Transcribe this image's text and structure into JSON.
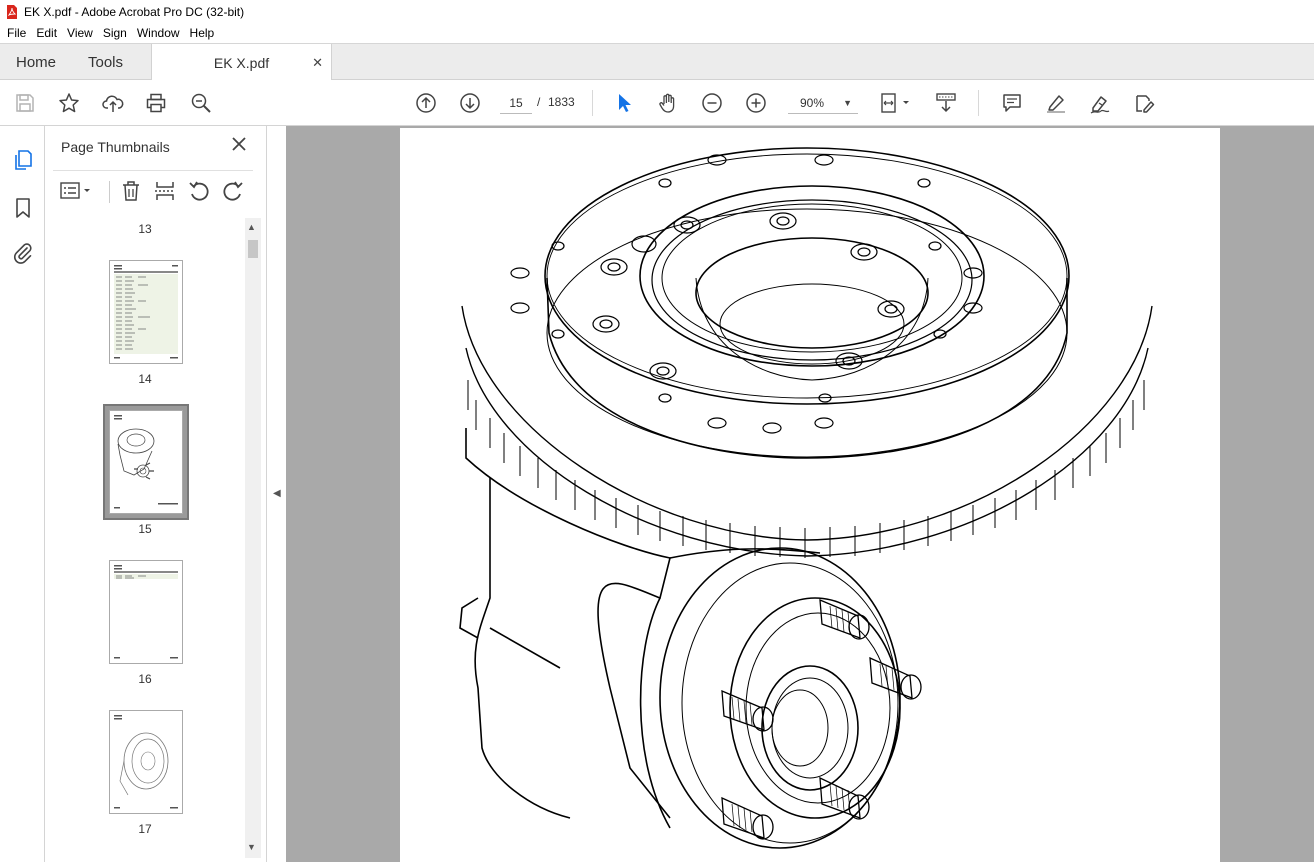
{
  "window": {
    "title": "EK X.pdf - Adobe Acrobat Pro DC (32-bit)"
  },
  "menu": {
    "items": [
      "File",
      "Edit",
      "View",
      "Sign",
      "Window",
      "Help"
    ]
  },
  "tabs": {
    "home": "Home",
    "tools": "Tools",
    "document": "EK X.pdf"
  },
  "toolbar": {
    "current_page": "15",
    "page_separator": "/",
    "total_pages": "1833",
    "zoom": "90%"
  },
  "thumbnails_panel": {
    "title": "Page Thumbnails",
    "pages": [
      {
        "number": "13"
      },
      {
        "number": "14"
      },
      {
        "number": "15",
        "selected": true
      },
      {
        "number": "16"
      },
      {
        "number": "17"
      }
    ]
  },
  "icons": {
    "app": "acrobat-icon",
    "save": "save-icon",
    "bookmark_star": "star-icon",
    "upload": "upload-icon",
    "print": "print-icon",
    "search": "zoom-search-icon",
    "prev_page": "arrow-up-circle-icon",
    "next_page": "arrow-down-circle-icon",
    "select": "pointer-icon",
    "hand": "hand-icon",
    "zoom_out": "zoom-out-icon",
    "zoom_in": "zoom-in-icon",
    "fit": "fit-page-icon",
    "scroll_mode": "scroll-mode-icon",
    "comment": "comment-icon",
    "highlight": "highlight-icon",
    "sign": "sign-icon",
    "edit": "edit-pdf-icon"
  },
  "colors": {
    "accent": "#1473e6",
    "acrobat_red": "#d9261c",
    "canvas_gray": "#a9a9a9"
  }
}
